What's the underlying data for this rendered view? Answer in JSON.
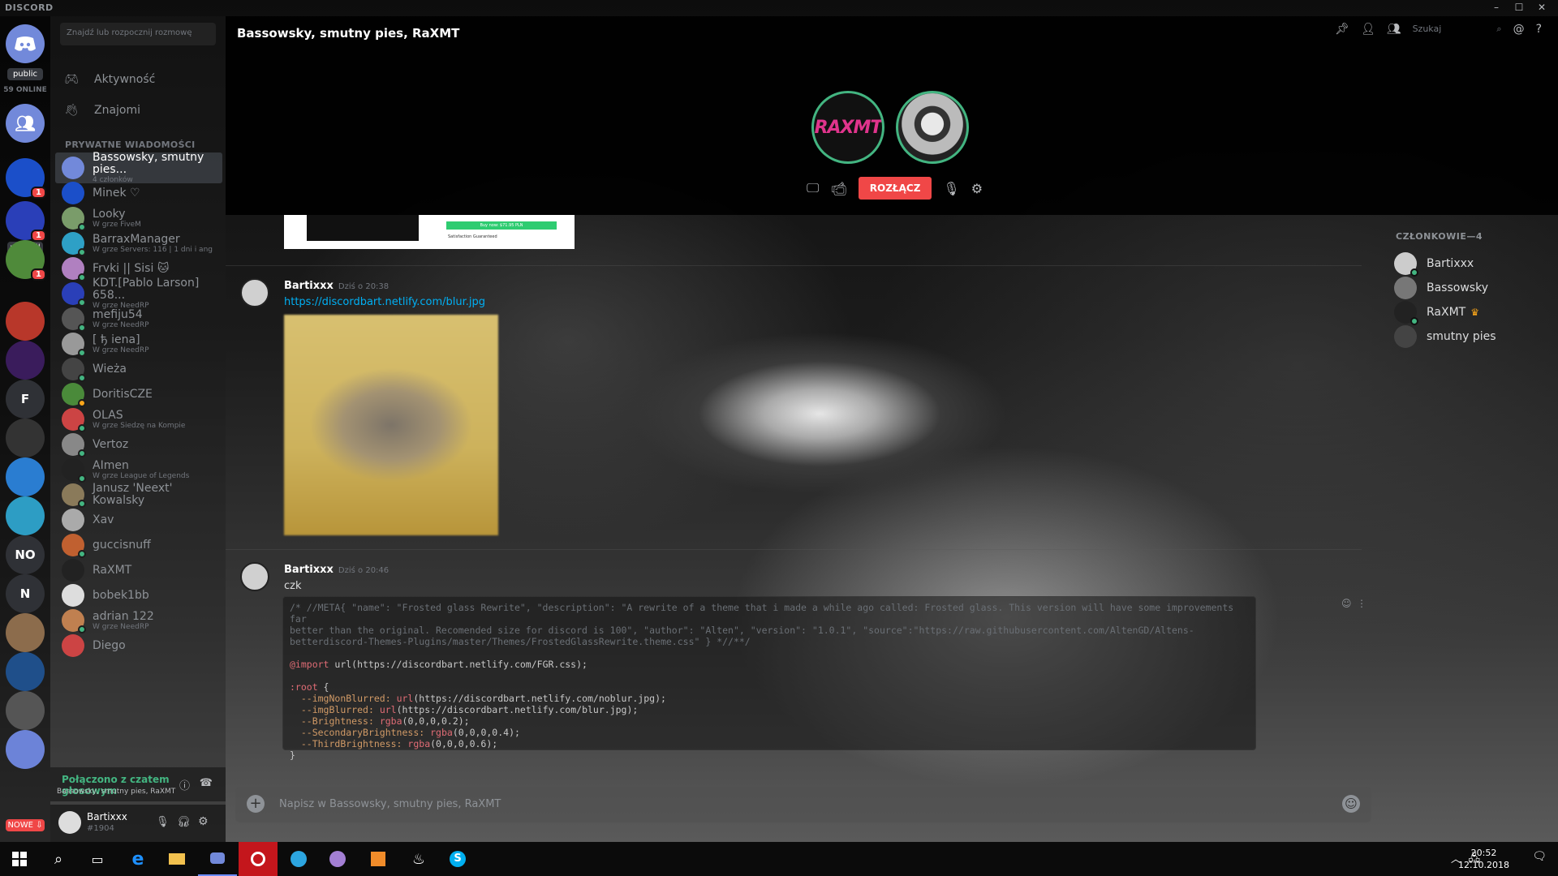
{
  "app": {
    "brand": "DISCORD",
    "window_controls": [
      "–",
      "☐",
      "✕"
    ]
  },
  "guilds": {
    "public_label": "public",
    "online_label": "59 ONLINE",
    "read_all_label": "read all",
    "new_label": "NOWE ⇩",
    "items": [
      {
        "kind": "icon",
        "icon": "group-icon",
        "color": "#7289da"
      },
      {
        "kind": "img",
        "name": "MINEK",
        "color": "#1b4fc9",
        "badge": "1"
      },
      {
        "kind": "img",
        "name": "server-x",
        "color": "#2a3fb8",
        "badge": "1"
      },
      {
        "kind": "img",
        "name": "server-face",
        "color": "#4f8a3a",
        "badge": "1"
      },
      {
        "kind": "img",
        "name": "server-anim",
        "color": "#b8372a"
      },
      {
        "kind": "img",
        "name": "server-B",
        "color": "#3a1c5c"
      },
      {
        "kind": "letter",
        "label": "F",
        "color": "#2f3136"
      },
      {
        "kind": "img",
        "name": "server-W",
        "color": "#333"
      },
      {
        "kind": "img",
        "name": "server-CWPB",
        "color": "#2a7dd1"
      },
      {
        "kind": "img",
        "name": "server-bot",
        "color": "#2d9dc4"
      },
      {
        "kind": "letter",
        "label": "NO",
        "color": "#2f3136"
      },
      {
        "kind": "letter",
        "label": "N",
        "color": "#2f3136"
      },
      {
        "kind": "img",
        "name": "server-man",
        "color": "#8c6c4c"
      },
      {
        "kind": "img",
        "name": "server-A",
        "color": "#1f4f8a"
      },
      {
        "kind": "img",
        "name": "server-grid",
        "color": "#555"
      },
      {
        "kind": "img",
        "name": "server-robot",
        "color": "#6c83d8"
      }
    ]
  },
  "dms": {
    "search_placeholder": "Znajdź lub rozpocznij rozmowę",
    "nav": [
      {
        "label": "Aktywność",
        "icon": "controller-icon"
      },
      {
        "label": "Znajomi",
        "icon": "wave-icon"
      }
    ],
    "header": "PRYWATNE WIADOMOŚCI",
    "items": [
      {
        "name": "Bassowsky, smutny pies...",
        "sub": "4 członków",
        "color": "#7289da",
        "status": "",
        "active": true
      },
      {
        "name": "Minek ♡",
        "sub": "",
        "color": "#1b4fc9",
        "status": ""
      },
      {
        "name": "Looky",
        "sub": "W grze FiveM",
        "color": "#7a9c6a",
        "status": "#43b581"
      },
      {
        "name": "BarraxManager",
        "sub": "W grze Servers: 116 | 1 dni i ang",
        "color": "#2ea0c6",
        "status": "#43b581"
      },
      {
        "name": "Frvki || Sisi 🐱",
        "sub": "",
        "color": "#b080c0",
        "status": "#43b581"
      },
      {
        "name": "KDT.[Pablo Larson] 658...",
        "sub": "W grze NeedRP",
        "color": "#2a3fb8",
        "status": "#43b581"
      },
      {
        "name": "mefiju54",
        "sub": "W grze NeedRP",
        "color": "#555",
        "status": "#43b581"
      },
      {
        "name": "[ ђ iena]",
        "sub": "W grze NeedRP",
        "color": "#999",
        "status": "#43b581"
      },
      {
        "name": "Wieża",
        "sub": "",
        "color": "#444",
        "status": "#43b581"
      },
      {
        "name": "DoritisCZE",
        "sub": "",
        "color": "#4a8a3a",
        "status": "#faa61a"
      },
      {
        "name": "OLAS",
        "sub": "W grze Siedzę na Kompie",
        "color": "#c44",
        "status": "#43b581"
      },
      {
        "name": "Vertoz",
        "sub": "",
        "color": "#888",
        "status": "#43b581"
      },
      {
        "name": "AImen",
        "sub": "W grze League of Legends",
        "color": "#222",
        "status": "#43b581"
      },
      {
        "name": "Janusz 'Neext' Kowalsky",
        "sub": "",
        "color": "#8a7a5a",
        "status": "#43b581"
      },
      {
        "name": "Xav",
        "sub": "",
        "color": "#aaa",
        "status": ""
      },
      {
        "name": "guccisnuff",
        "sub": "",
        "color": "#c06030",
        "status": "#43b581"
      },
      {
        "name": "RaXMT",
        "sub": "",
        "color": "#222",
        "status": ""
      },
      {
        "name": "bobek1bb",
        "sub": "",
        "color": "#ddd",
        "status": ""
      },
      {
        "name": "adrian 122",
        "sub": "W grze NeedRP",
        "color": "#c08050",
        "status": "#43b581"
      },
      {
        "name": "Diego",
        "sub": "",
        "color": "#c44",
        "status": ""
      }
    ]
  },
  "voice": {
    "status": "Połączono z czatem głosowym",
    "channel": "Bassowsky, smutny pies, RaXMT"
  },
  "user": {
    "name": "Bartixxx",
    "discriminator": "#1904"
  },
  "channel": {
    "title": "Bassowsky, smutny pies, RaXMT",
    "search_placeholder": "Szukaj"
  },
  "call": {
    "participants": [
      {
        "name": "RaXMT",
        "label": "RAXMT"
      },
      {
        "name": "Bassowsky"
      }
    ],
    "disconnect_label": "ROZŁĄCZ"
  },
  "embed": {
    "cta": "Buy now: $71.95 PLN",
    "guarantee": "Satisfaction Guaranteed"
  },
  "messages": [
    {
      "author": "Bartixxx",
      "time": "Dziś o 20:38",
      "link": "https://discordbart.netlify.com/blur.jpg"
    },
    {
      "author": "Bartixxx",
      "time": "Dziś o 20:46",
      "text": "czk"
    }
  ],
  "code": [
    {
      "t": "cm",
      "v": "/* //META{ \"name\": \"Frosted glass Rewrite\", \"description\": \"A rewrite of a theme that i made a while ago called: Frosted glass. This version will have some improvements far\nbetter than the original. Recomended size for discord is 100\", \"author\": \"Alten\", \"version\": \"1.0.1\", \"source\":\"https://raw.githubusercontent.com/AltenGD/Altens-\nbetterdiscord-Themes-Plugins/master/Themes/FrostedGlassRewrite.theme.css\" } *//**/\n\n"
    },
    {
      "t": "kw",
      "v": "@import"
    },
    {
      "t": "",
      "v": " url(https://discordbart.netlify.com/FGR.css);\n\n"
    },
    {
      "t": "kw",
      "v": ":root"
    },
    {
      "t": "",
      "v": " {\n  "
    },
    {
      "t": "vr",
      "v": "--imgNonBlurred:"
    },
    {
      "t": "",
      "v": " "
    },
    {
      "t": "fn",
      "v": "url"
    },
    {
      "t": "",
      "v": "(https://discordbart.netlify.com/noblur.jpg);\n  "
    },
    {
      "t": "vr",
      "v": "--imgBlurred:"
    },
    {
      "t": "",
      "v": " "
    },
    {
      "t": "fn",
      "v": "url"
    },
    {
      "t": "",
      "v": "(https://discordbart.netlify.com/blur.jpg);\n  "
    },
    {
      "t": "vr",
      "v": "--Brightness:"
    },
    {
      "t": "",
      "v": " "
    },
    {
      "t": "fn",
      "v": "rgba"
    },
    {
      "t": "",
      "v": "(0,0,0,0.2);\n  "
    },
    {
      "t": "vr",
      "v": "--SecondaryBrightness:"
    },
    {
      "t": "",
      "v": " "
    },
    {
      "t": "fn",
      "v": "rgba"
    },
    {
      "t": "",
      "v": "(0,0,0,0.4);\n  "
    },
    {
      "t": "vr",
      "v": "--ThirdBrightness:"
    },
    {
      "t": "",
      "v": " "
    },
    {
      "t": "fn",
      "v": "rgba"
    },
    {
      "t": "",
      "v": "(0,0,0,0.6);\n}"
    }
  ],
  "input": {
    "placeholder": "Napisz w Bassowsky, smutny pies, RaXMT"
  },
  "members": {
    "header": "CZŁONKOWIE—4",
    "items": [
      {
        "name": "Bartixxx",
        "color": "#ccc",
        "status": "#43b581",
        "crown": ""
      },
      {
        "name": "Bassowsky",
        "color": "#777",
        "status": "",
        "crown": ""
      },
      {
        "name": "RaXMT",
        "color": "#222",
        "status": "#43b581",
        "crown": "♛"
      },
      {
        "name": "smutny pies",
        "color": "#444",
        "status": "",
        "crown": ""
      }
    ]
  },
  "taskbar": {
    "time": "20:52",
    "date": "12.10.2018",
    "notif_count": "1"
  }
}
